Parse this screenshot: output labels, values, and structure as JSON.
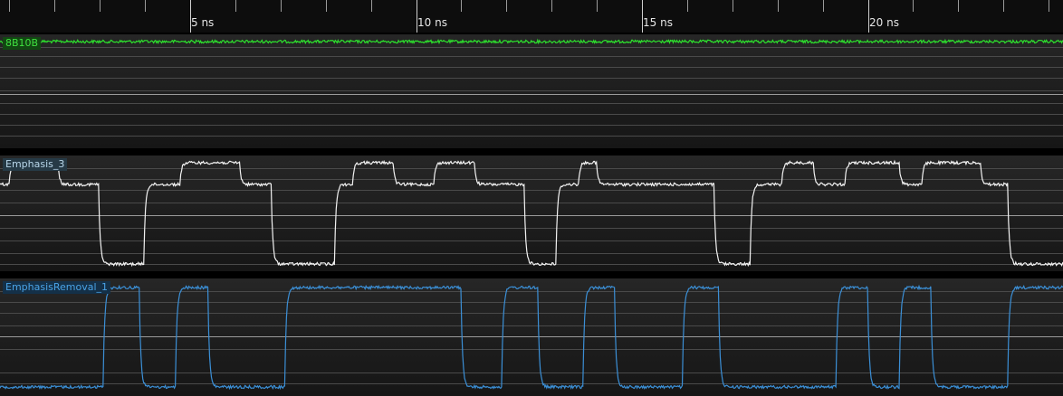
{
  "ruler": {
    "labels": [
      "5 ns",
      "10 ns",
      "15 ns",
      "20 ns"
    ]
  },
  "channels": [
    {
      "name": "8B10B",
      "color": "#2de12d",
      "label_bg": "#124712",
      "label_color": "#3fe03f",
      "initial_level": 0,
      "edges": [
        [
          0.0,
          1
        ],
        [
          6.3,
          1
        ],
        [
          8.3,
          1
        ],
        [
          11.2,
          1
        ],
        [
          12.1,
          1
        ],
        [
          13.2,
          1
        ],
        [
          14.3,
          1
        ],
        [
          15.3,
          1
        ],
        [
          16.2,
          1
        ],
        [
          17.4,
          1
        ],
        [
          18.1,
          1
        ],
        [
          19.1,
          1
        ],
        [
          19.9,
          1
        ],
        [
          21.3,
          1
        ],
        [
          22.3,
          1
        ],
        [
          23.2,
          1
        ]
      ]
    },
    {
      "name": "Emphasis_3",
      "color": "#f2f2f2",
      "label_bg": "#263a46",
      "label_color": "#b9d7ea",
      "initial_level": 0,
      "edges": [
        [
          0.0,
          1
        ],
        [
          0.2,
          2
        ],
        [
          1.3,
          1
        ],
        [
          2.2,
          0
        ],
        [
          3.2,
          1
        ],
        [
          4.0,
          2
        ],
        [
          5.3,
          1
        ],
        [
          6.0,
          0
        ],
        [
          7.4,
          1
        ],
        [
          7.8,
          2
        ],
        [
          8.7,
          1
        ],
        [
          9.6,
          2
        ],
        [
          10.5,
          1
        ],
        [
          11.6,
          0
        ],
        [
          12.3,
          1
        ],
        [
          12.8,
          2
        ],
        [
          13.2,
          1
        ],
        [
          15.8,
          0
        ],
        [
          16.6,
          1
        ],
        [
          17.3,
          2
        ],
        [
          18.0,
          1
        ],
        [
          18.7,
          2
        ],
        [
          19.9,
          1
        ],
        [
          20.4,
          2
        ],
        [
          21.7,
          1
        ],
        [
          22.3,
          0
        ]
      ]
    },
    {
      "name": "EmphasisRemoval_1",
      "color": "#3b8fd6",
      "label_bg": "#143048",
      "label_color": "#4aa3e6",
      "initial_level": 0,
      "edges": [
        [
          2.3,
          1
        ],
        [
          3.1,
          0
        ],
        [
          3.9,
          1
        ],
        [
          4.6,
          0
        ],
        [
          6.3,
          1
        ],
        [
          10.2,
          0
        ],
        [
          11.1,
          1
        ],
        [
          11.9,
          0
        ],
        [
          12.9,
          1
        ],
        [
          13.6,
          0
        ],
        [
          15.1,
          1
        ],
        [
          15.9,
          0
        ],
        [
          18.5,
          1
        ],
        [
          19.2,
          0
        ],
        [
          19.9,
          1
        ],
        [
          20.6,
          0
        ],
        [
          22.3,
          1
        ]
      ]
    }
  ]
}
